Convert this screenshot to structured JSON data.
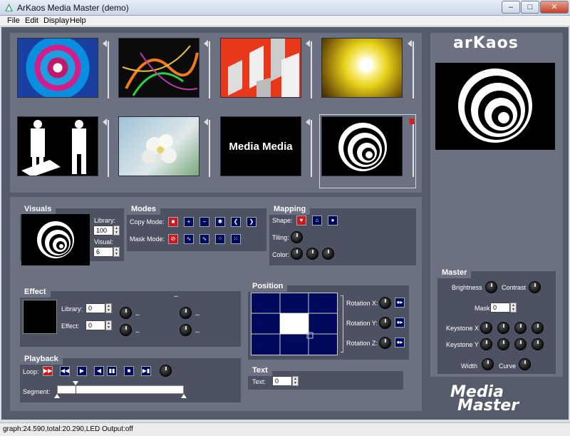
{
  "window": {
    "title": "ArKaos Media Master (demo)",
    "minimize": "–",
    "maximize": "□",
    "close": "✕"
  },
  "menu": [
    "File",
    "Edit",
    "Display",
    "Help"
  ],
  "brand": {
    "top_logo": "arKaos",
    "bottom_logo_line1": "Media",
    "bottom_logo_line2": "Master"
  },
  "thumbnails": [
    {
      "id": "t1",
      "kind": "rings-color"
    },
    {
      "id": "t2",
      "kind": "light-trails"
    },
    {
      "id": "t3",
      "kind": "red-cubes"
    },
    {
      "id": "t4",
      "kind": "yellow-burst"
    },
    {
      "id": "t5",
      "kind": "silhouettes"
    },
    {
      "id": "t6",
      "kind": "flowers"
    },
    {
      "id": "t7",
      "kind": "media-text",
      "text": "Media  Media"
    },
    {
      "id": "t8",
      "kind": "spiral",
      "selected": true
    }
  ],
  "visuals": {
    "title": "Visuals",
    "library_label": "Library:",
    "library_value": "100",
    "visual_label": "Visual:",
    "visual_value": "6"
  },
  "modes": {
    "title": "Modes",
    "copy_label": "Copy Mode:",
    "mask_label": "Mask Mode:"
  },
  "mapping": {
    "title": "Mapping",
    "shape_label": "Shape:",
    "tiling_label": "Tiling:",
    "color_label": "Color:"
  },
  "effect": {
    "title": "Effect",
    "library_label": "Library:",
    "library_value": "0",
    "effect_label": "Effect:",
    "effect_value": "0",
    "dash": "--"
  },
  "position": {
    "title": "Position",
    "rot_x": "Rotation X:",
    "rot_y": "Rotation Y:",
    "rot_z": "Rotation Z:"
  },
  "playback": {
    "title": "Playback",
    "loop_label": "Loop:",
    "segment_label": "Segment:"
  },
  "text_panel": {
    "title": "Text",
    "text_label": "Text:",
    "text_value": "0"
  },
  "master": {
    "title": "Master",
    "brightness": "Brightness",
    "contrast": "Contrast",
    "mask_label": "Mask",
    "mask_value": "0",
    "keystone_x": "Keystone X",
    "keystone_y": "Keystone Y",
    "width": "Width",
    "curve": "Curve"
  },
  "status": "graph:24.590,total:20.290,LED Output:off",
  "colors": {
    "bg_dark": "#545b6b",
    "panel": "#6b7180",
    "accent_red": "#d0161e",
    "btn_blue": "#000a5c"
  }
}
